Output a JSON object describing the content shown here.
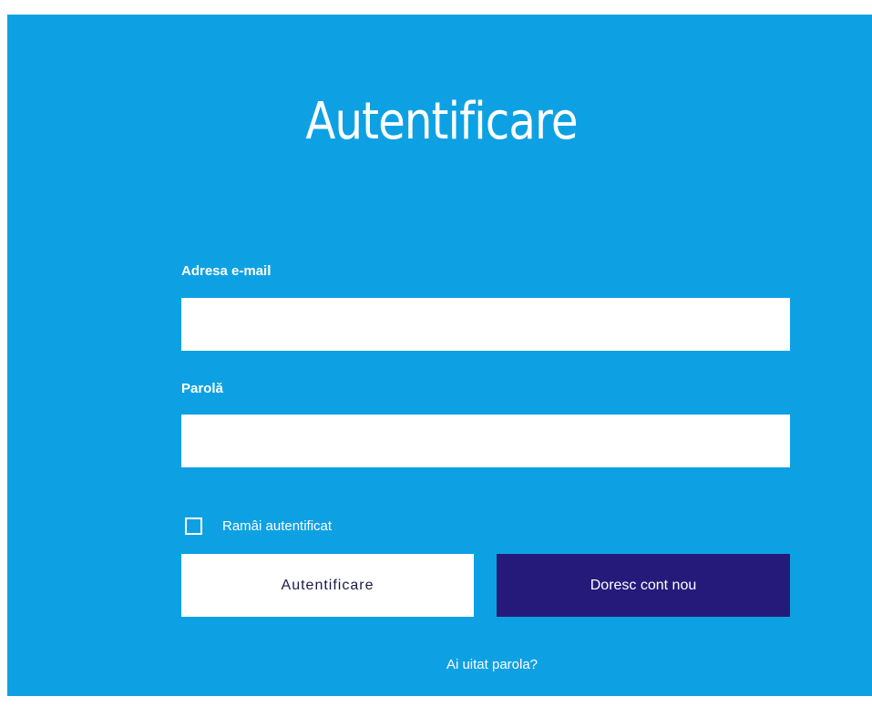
{
  "page": {
    "title": "Autentificare",
    "background_color": "#0da1e4"
  },
  "form": {
    "email": {
      "label": "Adresa e-mail",
      "value": "",
      "placeholder": ""
    },
    "password": {
      "label": "Parolă",
      "value": "",
      "placeholder": ""
    },
    "remember": {
      "label": "Ramâi autentificat",
      "checked": false
    },
    "buttons": {
      "login_label": "Autentificare",
      "register_label": "Doresc cont nou",
      "register_color": "#251a7a"
    },
    "forgot_password_label": "Ai uitat parola?"
  }
}
